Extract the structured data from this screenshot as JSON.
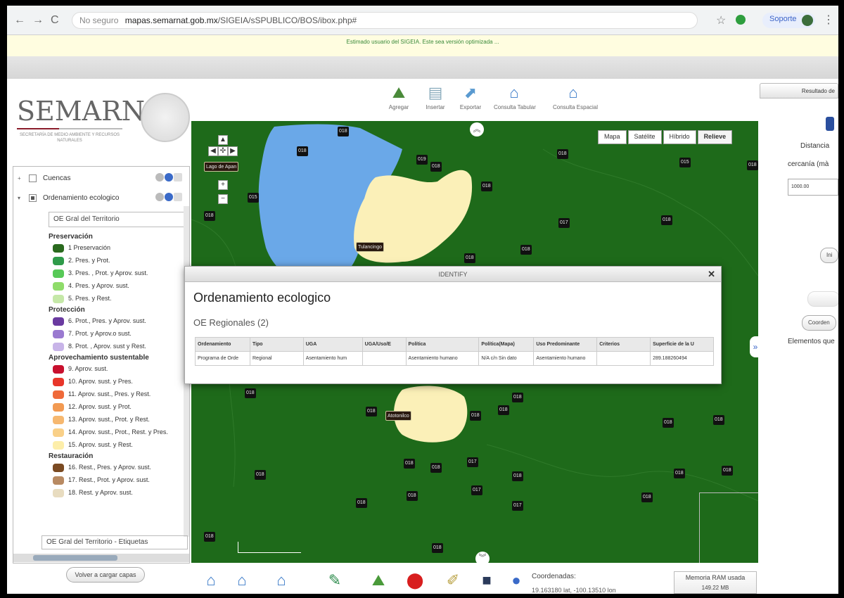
{
  "browser": {
    "insecure": "No seguro",
    "host": "mapas.semarnat.gob.mx",
    "path": "/SIGEIA/sSPUBLICO/BOS/ibox.php#",
    "profile": "Soporte"
  },
  "notice": "Estimado usuario del SIGEIA. Este sea versión optimizada ...",
  "logo": {
    "title": "SEMARNAT",
    "subtitle": "SECRETARÍA DE MEDIO AMBIENTE Y RECURSOS NATURALES"
  },
  "toolbar": [
    {
      "label": "Agregar",
      "icon": "add-layer-icon"
    },
    {
      "label": "Insertar",
      "icon": "insert-table-icon"
    },
    {
      "label": "Exportar",
      "icon": "export-icon"
    },
    {
      "label": "Consulta Tabular",
      "icon": "tabular-query-icon"
    },
    {
      "label": "Consulta Espacial",
      "icon": "spatial-query-icon"
    }
  ],
  "right_panel": {
    "tab": "Resultado de",
    "distancia": "Distancia",
    "cercania": "cercanía (mà",
    "input_value": "1000.00",
    "btn_ini": "Ini",
    "btn_coord": "Coorden",
    "elementos": "Elementos que"
  },
  "layers": [
    {
      "name": "Cuencas",
      "expander": "+",
      "checked": false
    },
    {
      "name": "Ordenamiento ecologico",
      "expander": "▾",
      "checked": true
    }
  ],
  "oe_select": "OE Gral del Territorio",
  "legend": {
    "groups": [
      {
        "title": "Preservación",
        "items": [
          {
            "label": "1 Preservación",
            "color": "#2a6a1e"
          },
          {
            "label": "2. Pres. y Prot.",
            "color": "#2f9b4a"
          },
          {
            "label": "3. Pres. , Prot. y Aprov. sust.",
            "color": "#57c957"
          },
          {
            "label": "4. Pres. y Aprov. sust.",
            "color": "#8fdc6a"
          },
          {
            "label": "5. Pres. y Rest.",
            "color": "#c5e8a8"
          }
        ]
      },
      {
        "title": "Protección",
        "items": [
          {
            "label": "6. Prot., Pres. y Aprov. sust.",
            "color": "#6a3aa0"
          },
          {
            "label": "7. Prot. y Aprov.o sust.",
            "color": "#9a7ad0"
          },
          {
            "label": "8. Prot. , Aprov. sust y Rest.",
            "color": "#c8b4e8"
          }
        ]
      },
      {
        "title": "Aprovechamiento sustentable",
        "items": [
          {
            "label": "9.  Aprov. sust.",
            "color": "#c8102e"
          },
          {
            "label": "10. Aprov. sust. y Pres.",
            "color": "#e8362a"
          },
          {
            "label": "11. Aprov. sust., Pres. y Rest.",
            "color": "#ef6a3a"
          },
          {
            "label": "12. Aprov. sust. y Prot.",
            "color": "#f29a52"
          },
          {
            "label": "13. Aprov. sust., Prot. y Rest.",
            "color": "#f6b870"
          },
          {
            "label": "14. Aprov. sust., Prot., Rest. y Pres.",
            "color": "#f9d088"
          },
          {
            "label": "15. Aprov. sust. y Rest.",
            "color": "#fdeeaa"
          }
        ]
      },
      {
        "title": "Restauración",
        "items": [
          {
            "label": "16. Rest., Pres. y Aprov. sust.",
            "color": "#7a4a22"
          },
          {
            "label": "17. Rest., Prot. y Aprov. sust.",
            "color": "#b88a62"
          },
          {
            "label": "18. Rest. y Aprov. sust.",
            "color": "#e8dcc0"
          }
        ]
      }
    ]
  },
  "etiquetas_layer": "OE Gral del Territorio - Etiquetas",
  "reload_button": "Volver a cargar capas",
  "map": {
    "types": [
      "Mapa",
      "Satélite",
      "Híbrido",
      "Relieve"
    ],
    "active_type": "Relieve",
    "colors": {
      "land": "#1e6a1a",
      "water": "#6aa8e8",
      "urban": "#fbf0b8"
    },
    "labels": [
      "018",
      "018",
      "019",
      "018",
      "018",
      "015",
      "018",
      "018",
      "015",
      "018",
      "017",
      "018",
      "018",
      "018",
      "018",
      "018",
      "018",
      "018",
      "018",
      "018",
      "018",
      "018",
      "018",
      "018",
      "017",
      "018",
      "018",
      "018",
      "018",
      "018",
      "017",
      "017",
      "018",
      "018",
      "018"
    ],
    "places": [
      "Lago de Apan",
      "Tulancingo",
      "Atotonilco"
    ]
  },
  "identify": {
    "title": "IDENTIFY",
    "heading": "Ordenamiento ecologico",
    "subheading": "OE Regionales (2)",
    "columns": [
      "Ordenamiento",
      "Tipo",
      "UGA",
      "UGA/Uso/E",
      "Política",
      "Política(Mapa)",
      "Uso Predominante",
      "Criterios",
      "Superficie de la U"
    ],
    "row": [
      "Programa de Orde",
      "Regional",
      "Asentamiento hum",
      "",
      "Asentamiento humano",
      "N/A c/n Sin dato",
      "Asentamiento humano",
      "",
      "289.188260494"
    ]
  },
  "coordinates": {
    "label": "Coordenadas:",
    "value": "19.163180 lat, -100.13510 lon"
  },
  "ram": {
    "label": "Memoria RAM usada",
    "value": "149.22 MB"
  }
}
